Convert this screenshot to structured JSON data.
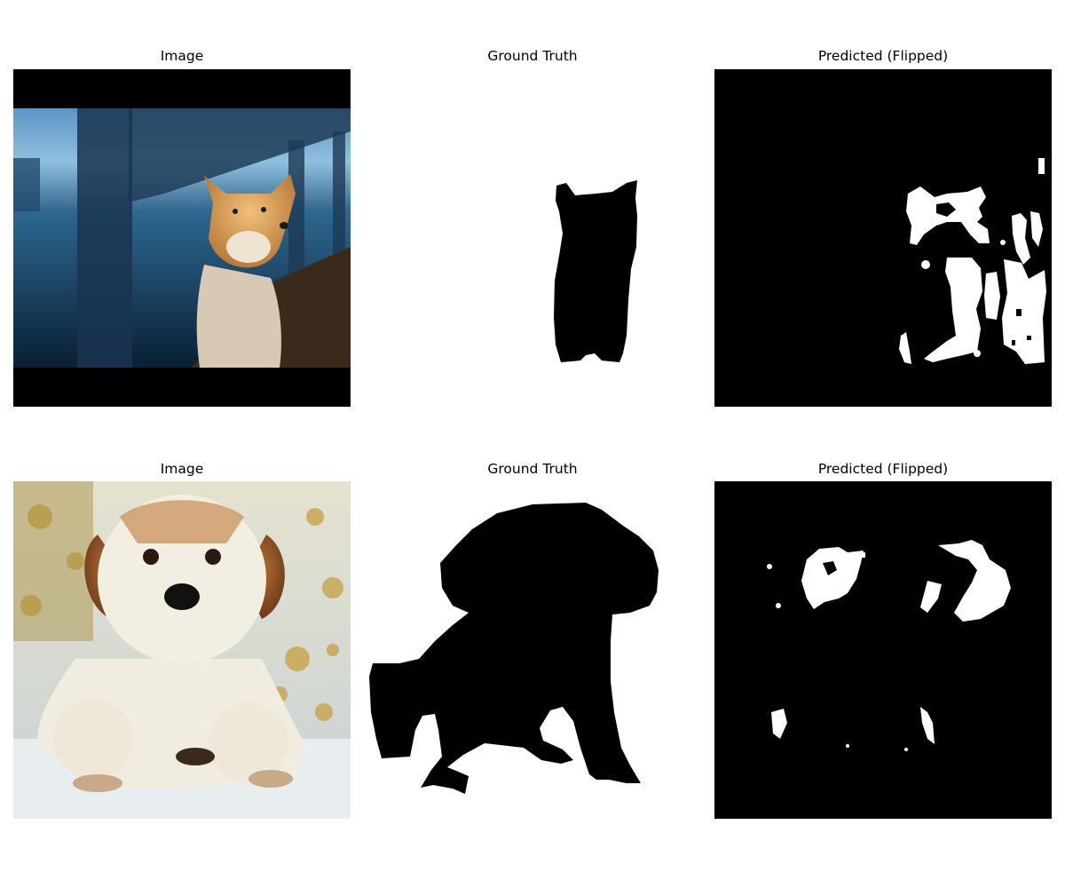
{
  "figure": {
    "rows": [
      {
        "panels": [
          {
            "title": "Image",
            "content": "photo",
            "subject": "shiba-inu dog sitting by water under a bridge at dusk"
          },
          {
            "title": "Ground Truth",
            "content": "mask"
          },
          {
            "title": "Predicted (Flipped)",
            "content": "mask"
          }
        ]
      },
      {
        "panels": [
          {
            "title": "Image",
            "content": "photo",
            "subject": "spaniel puppy sitting on floral bedding"
          },
          {
            "title": "Ground Truth",
            "content": "mask"
          },
          {
            "title": "Predicted (Flipped)",
            "content": "mask"
          }
        ]
      }
    ],
    "colors": {
      "mask_foreground": "#000000",
      "mask_background": "#ffffff"
    }
  }
}
